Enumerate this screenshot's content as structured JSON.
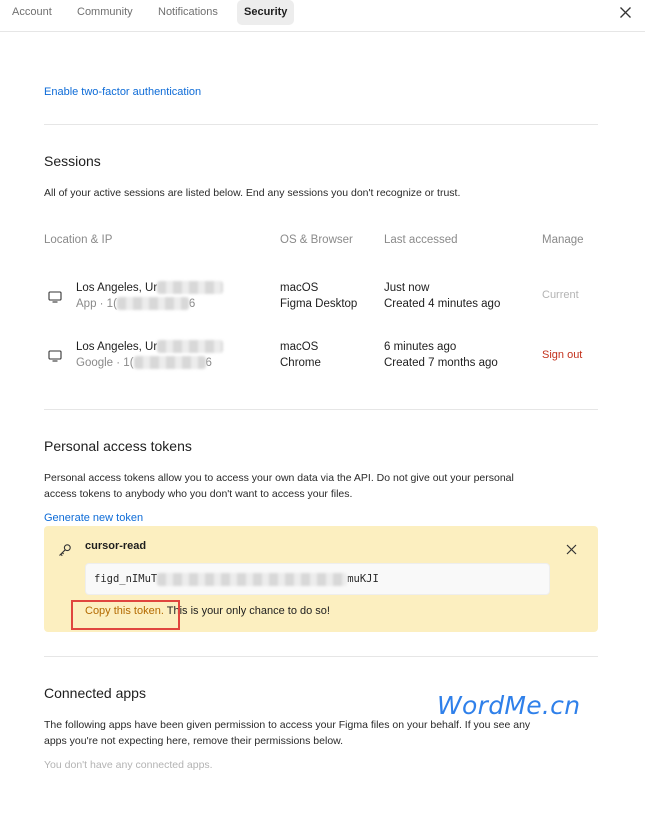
{
  "tabs": [
    {
      "label": "Account"
    },
    {
      "label": "Community"
    },
    {
      "label": "Notifications"
    },
    {
      "label": "Security"
    }
  ],
  "two_factor_link": "Enable two-factor authentication",
  "sessions": {
    "title": "Sessions",
    "description": "All of your active sessions are listed below. End any sessions you don't recognize or trust.",
    "columns": [
      "Location & IP",
      "OS & Browser",
      "Last accessed",
      "Manage"
    ],
    "rows": [
      {
        "location": "Los Angeles, Ur",
        "ip": "App · 1(",
        "ip_tail": "6",
        "os": "macOS",
        "browser": "Figma Desktop",
        "last": "Just now",
        "created": "Created 4 minutes ago",
        "manage": "Current"
      },
      {
        "location": "Los Angeles, Ur",
        "ip": "Google · 1(",
        "ip_tail": "6",
        "os": "macOS",
        "browser": "Chrome",
        "last": "6 minutes ago",
        "created": "Created 7 months ago",
        "manage": "Sign out"
      }
    ]
  },
  "tokens": {
    "title": "Personal access tokens",
    "description_line1": "Personal access tokens allow you to access your own data via the API. Do not give out your personal",
    "description_line2": "access tokens to anybody who you don't want to access your files.",
    "generate_link": "Generate new token",
    "card": {
      "name": "cursor-read",
      "token_start": "figd_nIMuT",
      "token_end": "muKJI",
      "copy_prefix": "Copy this token.",
      "copy_suffix": " This is your only chance to do so!"
    }
  },
  "connected_apps": {
    "title": "Connected apps",
    "description_line1": "The following apps have been given permission to access your Figma files on your behalf. If you see any",
    "description_line2": "apps you're not expecting here, remove their permissions below.",
    "empty": "You don't have any connected apps."
  },
  "watermark": "WordMe.cn",
  "colors": {
    "accent": "#0d6bd7",
    "danger": "#c3311c",
    "token_bg": "#fcefc0",
    "highlight": "#e0463e"
  }
}
